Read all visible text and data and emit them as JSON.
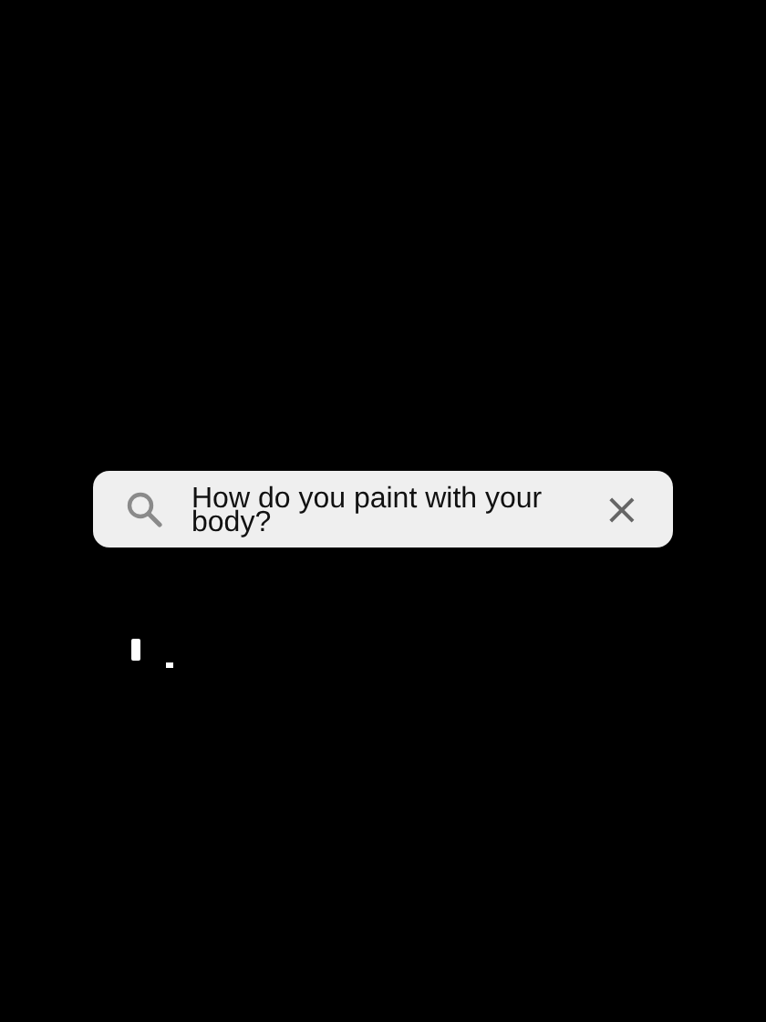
{
  "search": {
    "value": "How do you paint with your body?",
    "clear_label": "×"
  }
}
